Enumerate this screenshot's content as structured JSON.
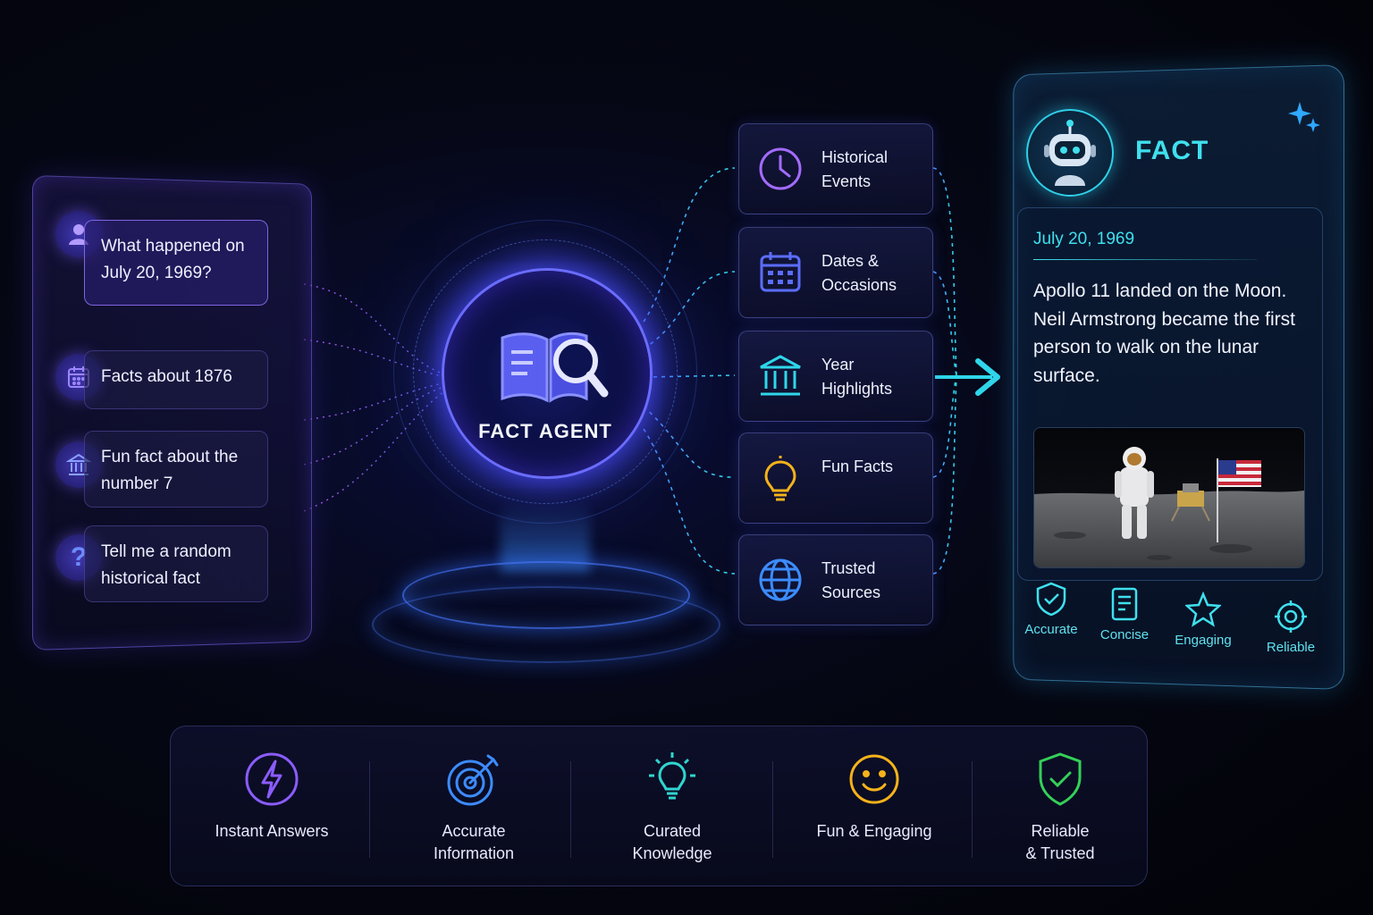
{
  "queries": [
    {
      "text": "What happened on July 20, 1969?",
      "icon": "user-icon"
    },
    {
      "text": "Facts about 1876",
      "icon": "calendar-icon"
    },
    {
      "text": "Fun fact about the number 7",
      "icon": "bank-icon"
    },
    {
      "text": "Tell me a random historical fact",
      "icon": "question-icon"
    }
  ],
  "agent": {
    "label": "FACT AGENT",
    "icon": "book-search-icon"
  },
  "categories": [
    {
      "label": "Historical Events",
      "icon": "clock-icon",
      "color": "#a36bff"
    },
    {
      "label": "Dates & Occasions",
      "icon": "calendar-icon",
      "color": "#5b6dff"
    },
    {
      "label": "Year Highlights",
      "icon": "museum-icon",
      "color": "#2fd6ea"
    },
    {
      "label": "Fun Facts",
      "icon": "lightbulb-icon",
      "color": "#f5b21b"
    },
    {
      "label": "Trusted Sources",
      "icon": "globe-icon",
      "color": "#3c8cff"
    }
  ],
  "fact_card": {
    "title": "FACT",
    "date": "July 20, 1969",
    "text": "Apollo 11 landed on the Moon. Neil Armstrong became the first person to walk on the lunar surface.",
    "traits": [
      "Accurate",
      "Concise",
      "Engaging",
      "Reliable"
    ]
  },
  "features": [
    {
      "label": "Instant Answers",
      "icon": "lightning-icon",
      "color": "#8b5cff"
    },
    {
      "label": "Accurate\nInformation",
      "icon": "target-icon",
      "color": "#3c8cff"
    },
    {
      "label": "Curated\nKnowledge",
      "icon": "lightbulb-icon",
      "color": "#2fd6d0"
    },
    {
      "label": "Fun & Engaging",
      "icon": "smiley-icon",
      "color": "#f5b21b"
    },
    {
      "label": "Reliable\n& Trusted",
      "icon": "shield-check-icon",
      "color": "#34d058"
    }
  ],
  "colors": {
    "accent_purple": "#7a5cff",
    "accent_cyan": "#2fd6ea",
    "background": "#050714"
  }
}
